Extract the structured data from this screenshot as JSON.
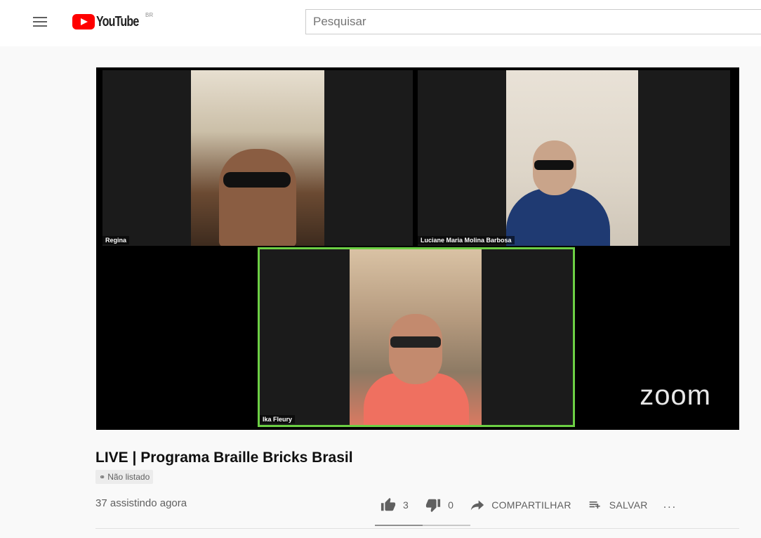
{
  "header": {
    "logo_text": "YouTube",
    "region": "BR",
    "search_placeholder": "Pesquisar"
  },
  "video": {
    "participants": [
      {
        "name": "Regina"
      },
      {
        "name": "Luciane Maria Molina Barbosa"
      },
      {
        "name": "Ika Fleury"
      }
    ],
    "watermark": "zoom"
  },
  "info": {
    "title": "LIVE | Programa Braille Bricks Brasil",
    "visibility": "Não listado",
    "viewers": "37 assistindo agora",
    "likes": "3",
    "dislikes": "0",
    "share_label": "COMPARTILHAR",
    "save_label": "SALVAR",
    "more_label": "...",
    "like_ratio": 1.0
  },
  "colors": {
    "brand_red": "#ff0000",
    "active_speaker": "#6ccf44"
  }
}
